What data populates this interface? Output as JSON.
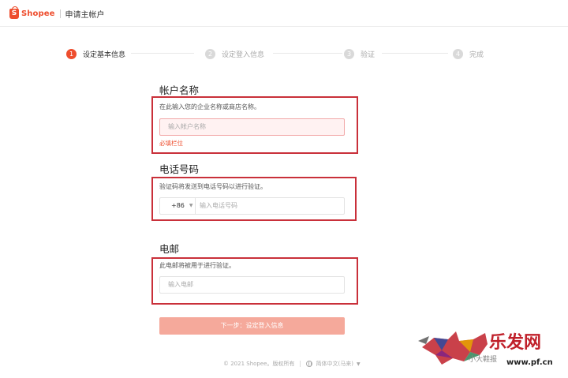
{
  "header": {
    "brand_letter": "S",
    "brand": "Shopee",
    "title": "申请主帐户"
  },
  "steps": [
    {
      "num": "1",
      "label": "设定基本信息",
      "active": true
    },
    {
      "num": "2",
      "label": "设定登入信息",
      "active": false
    },
    {
      "num": "3",
      "label": "验证",
      "active": false
    },
    {
      "num": "4",
      "label": "完成",
      "active": false
    }
  ],
  "account": {
    "title": "帐户名称",
    "hint": "在此输入您的企业名称或商店名称。",
    "placeholder": "输入帐户名称",
    "error": "必填栏位"
  },
  "phone": {
    "title": "电话号码",
    "hint": "验证码将发送到电话号码以进行验证。",
    "prefix": "+86",
    "placeholder": "输入电话号码"
  },
  "email": {
    "title": "电邮",
    "hint": "此电邮将被用于进行验证。",
    "placeholder": "输入电邮"
  },
  "next_button": "下一步：设定登入信息",
  "footer": {
    "copyright": "© 2021 Shopee。版权所有",
    "language": "简体中文(马来)"
  },
  "watermark": {
    "logo_text": "乐发网",
    "small_text": "小大鞋报",
    "url": "www.pf.cn"
  },
  "colors": {
    "brand": "#ee4d2d",
    "highlight_box": "#c9303a",
    "button_disabled": "#f5a99b"
  }
}
